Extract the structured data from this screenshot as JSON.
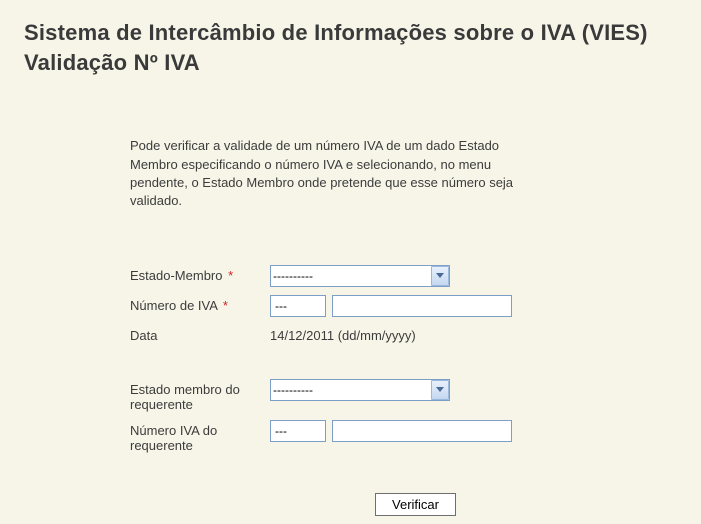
{
  "page": {
    "title": "Sistema de Intercâmbio de Informações sobre o IVA (VIES) Validação Nº IVA"
  },
  "intro": {
    "text": "Pode verificar a validade de um número IVA de um dado Estado Membro especificando o número IVA e selecionando, no menu pendente, o Estado Membro onde pretende que esse número seja validado."
  },
  "form": {
    "member_state": {
      "label": "Estado-Membro",
      "required": "*",
      "selected": "----------"
    },
    "vat_number": {
      "label": "Número de IVA",
      "required": "*",
      "country_code": "---",
      "number": ""
    },
    "date": {
      "label": "Data",
      "value": "14/12/2011 (dd/mm/yyyy)"
    },
    "requester_state": {
      "label": "Estado membro do requerente",
      "selected": "----------"
    },
    "requester_vat": {
      "label": "Número IVA do requerente",
      "country_code": "---",
      "number": ""
    },
    "submit_label": "Verificar"
  }
}
